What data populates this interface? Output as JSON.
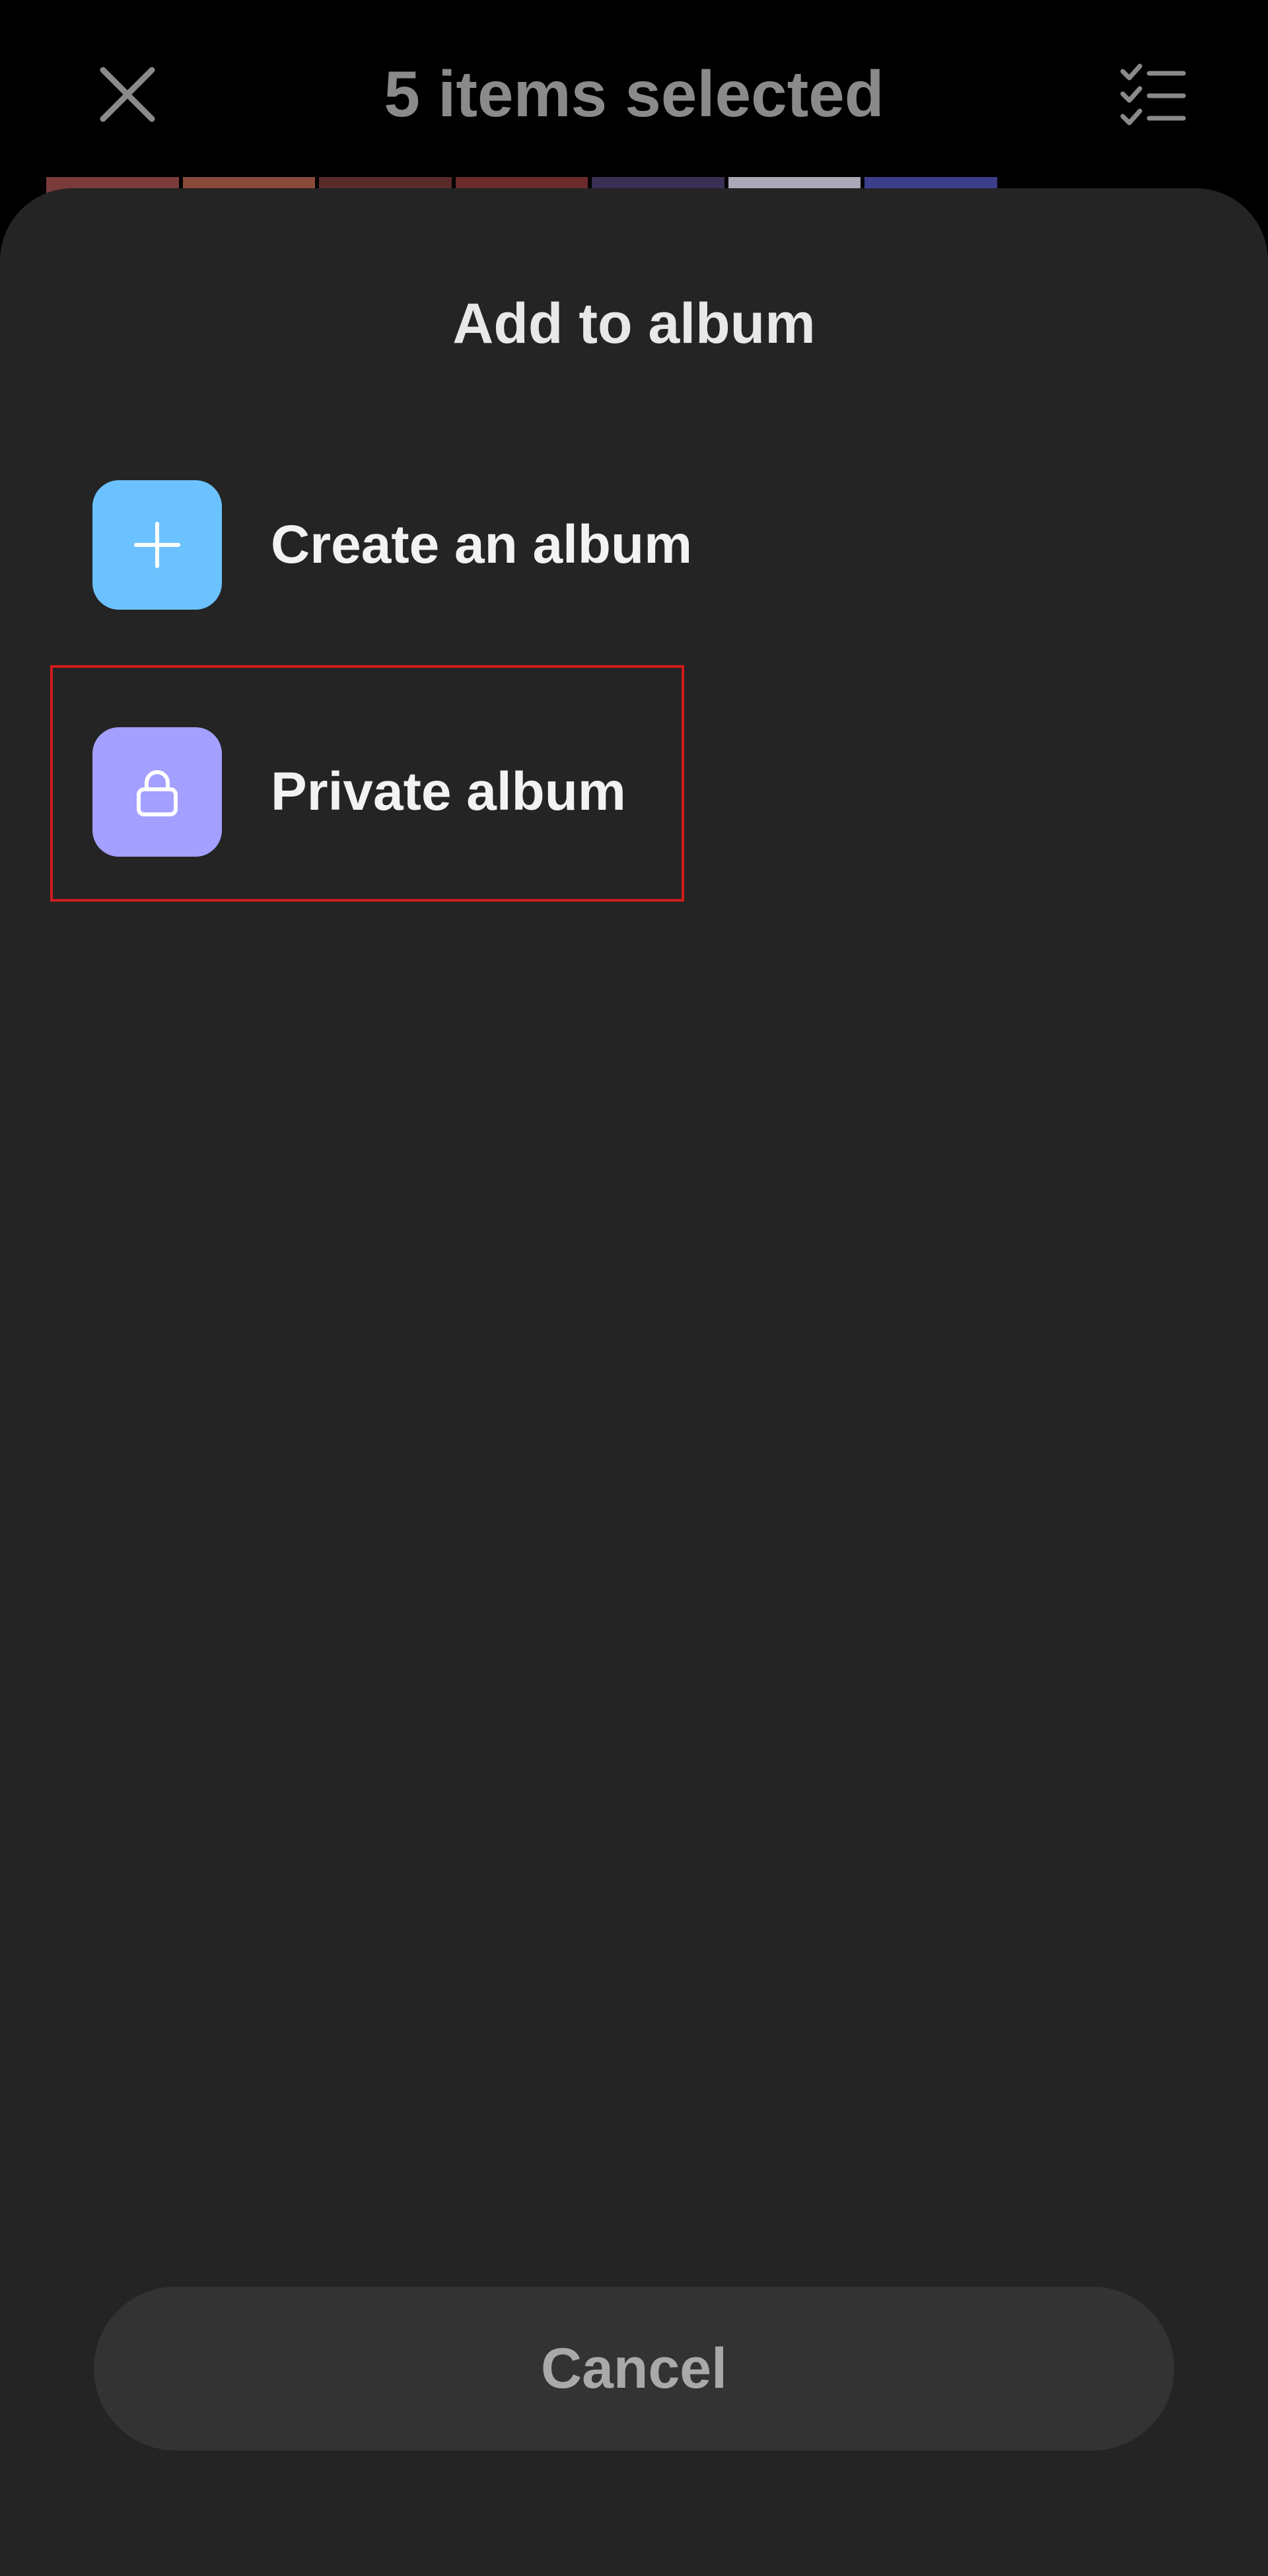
{
  "topbar": {
    "title": "5 items selected",
    "close_icon": "close-icon",
    "select_all_icon": "checklist-icon"
  },
  "thumbnails": {
    "colors": [
      "#7a3b3b",
      "#8a4a3a",
      "#5a2a2a",
      "#6b2b2b",
      "#3a2f55",
      "#a9a9b8",
      "#3b3f8a"
    ]
  },
  "sheet": {
    "title": "Add to album",
    "options": [
      {
        "label": "Create an album",
        "icon": "plus-icon",
        "icon_bg": "#6cc2ff"
      },
      {
        "label": "Private album",
        "icon": "lock-icon",
        "icon_bg": "#a3a0ff"
      }
    ],
    "cancel_label": "Cancel"
  },
  "colors": {
    "background": "#000000",
    "sheet": "#242424",
    "cancel_bg": "#333333",
    "highlight": "#d01c1c"
  }
}
